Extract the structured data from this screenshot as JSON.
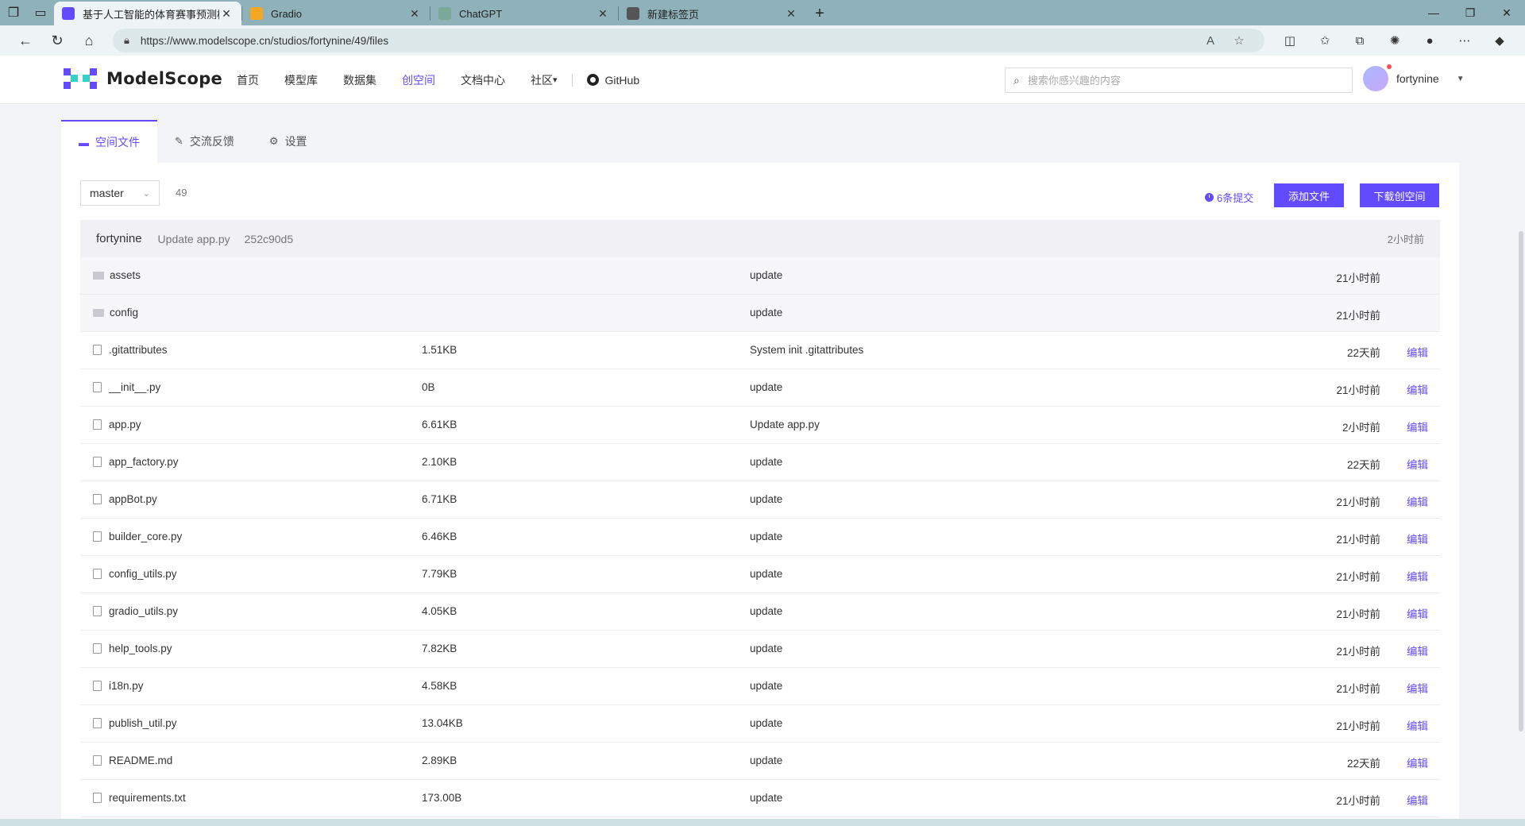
{
  "browser": {
    "tabs": [
      {
        "label": "基于人工智能的体育赛事预测模型",
        "favicon": "modelscope-icon",
        "favicon_color": "#624aff",
        "active": true
      },
      {
        "label": "Gradio",
        "favicon": "gradio-icon",
        "favicon_color": "#f5a623",
        "active": false
      },
      {
        "label": "ChatGPT",
        "favicon": "chatgpt-icon",
        "favicon_color": "#7aa99a",
        "active": false
      },
      {
        "label": "新建标签页",
        "favicon": "newtab-icon",
        "favicon_color": "#555555",
        "active": false
      }
    ],
    "url": "https://www.modelscope.cn/studios/fortynine/49/files"
  },
  "header": {
    "logo_text": "ModelScope",
    "nav": [
      "首页",
      "模型库",
      "数据集",
      "创空间",
      "文档中心",
      "社区"
    ],
    "active_nav": "创空间",
    "github_label": "GitHub",
    "search_placeholder": "搜索你感兴趣的内容",
    "username": "fortynine"
  },
  "page_tabs": [
    {
      "label": "空间文件",
      "icon": "folder-icon",
      "active": true
    },
    {
      "label": "交流反馈",
      "icon": "edit-icon",
      "active": false
    },
    {
      "label": "设置",
      "icon": "gear-icon",
      "active": false
    }
  ],
  "repo": {
    "branch": "master",
    "name": "49",
    "commits_label": "6条提交",
    "add_file_label": "添加文件",
    "download_label": "下载创空间"
  },
  "last_commit": {
    "author": "fortynine",
    "message": "Update app.py",
    "hash": "252c90d5",
    "time": "2小时前"
  },
  "edit_label": "编辑",
  "files": [
    {
      "name": "assets",
      "type": "dir",
      "size": "",
      "message": "update",
      "time": "21小时前"
    },
    {
      "name": "config",
      "type": "dir",
      "size": "",
      "message": "update",
      "time": "21小时前"
    },
    {
      "name": ".gitattributes",
      "type": "file",
      "size": "1.51KB",
      "message": "System init .gitattributes",
      "time": "22天前"
    },
    {
      "name": "__init__.py",
      "type": "file",
      "size": "0B",
      "message": "update",
      "time": "21小时前"
    },
    {
      "name": "app.py",
      "type": "file",
      "size": "6.61KB",
      "message": "Update app.py",
      "time": "2小时前"
    },
    {
      "name": "app_factory.py",
      "type": "file",
      "size": "2.10KB",
      "message": "update",
      "time": "22天前"
    },
    {
      "name": "appBot.py",
      "type": "file",
      "size": "6.71KB",
      "message": "update",
      "time": "21小时前"
    },
    {
      "name": "builder_core.py",
      "type": "file",
      "size": "6.46KB",
      "message": "update",
      "time": "21小时前"
    },
    {
      "name": "config_utils.py",
      "type": "file",
      "size": "7.79KB",
      "message": "update",
      "time": "21小时前"
    },
    {
      "name": "gradio_utils.py",
      "type": "file",
      "size": "4.05KB",
      "message": "update",
      "time": "21小时前"
    },
    {
      "name": "help_tools.py",
      "type": "file",
      "size": "7.82KB",
      "message": "update",
      "time": "21小时前"
    },
    {
      "name": "i18n.py",
      "type": "file",
      "size": "4.58KB",
      "message": "update",
      "time": "21小时前"
    },
    {
      "name": "publish_util.py",
      "type": "file",
      "size": "13.04KB",
      "message": "update",
      "time": "21小时前"
    },
    {
      "name": "README.md",
      "type": "file",
      "size": "2.89KB",
      "message": "update",
      "time": "22天前"
    },
    {
      "name": "requirements.txt",
      "type": "file",
      "size": "173.00B",
      "message": "update",
      "time": "21小时前"
    }
  ]
}
